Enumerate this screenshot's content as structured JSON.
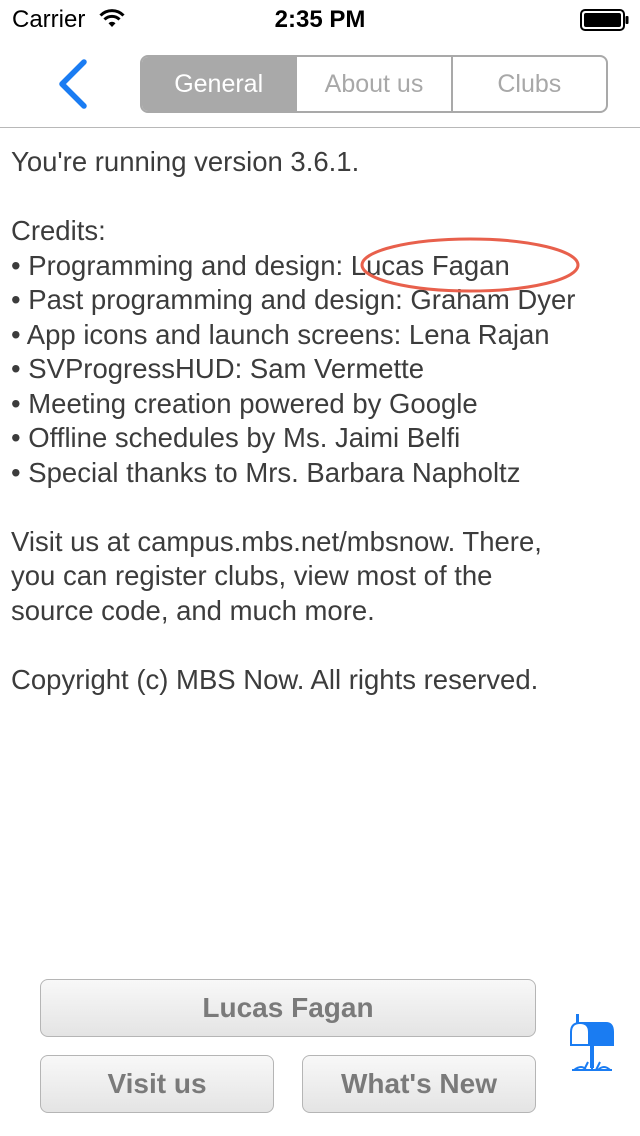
{
  "status_bar": {
    "carrier": "Carrier",
    "time": "2:35 PM",
    "wifi_icon": "wifi-icon",
    "battery_icon": "battery-icon"
  },
  "nav": {
    "back_icon": "chevron-left-icon",
    "tabs": [
      {
        "label": "General",
        "selected": true
      },
      {
        "label": "About us",
        "selected": false
      },
      {
        "label": "Clubs",
        "selected": false
      }
    ]
  },
  "content": {
    "version_text": "You're running version 3.6.1.",
    "credits_heading": "Credits:",
    "credits": [
      "• Programming and design: Lucas Fagan",
      "• Past programming and design: Graham Dyer",
      "• App icons and launch screens: Lena Rajan",
      "• SVProgressHUD: Sam Vermette",
      "• Meeting creation powered by Google",
      "• Offline schedules by Ms. Jaimi Belfi",
      "• Special thanks to Mrs. Barbara Napholtz"
    ],
    "visit_lines": [
      "Visit us at campus.mbs.net/mbsnow. There,",
      "you can register clubs, view most of the",
      "source code, and much more."
    ],
    "copyright": "Copyright (c) MBS Now. All rights reserved."
  },
  "buttons": {
    "name": "Lucas Fagan",
    "visit": "Visit us",
    "whats_new": "What's New"
  },
  "colors": {
    "accent": "#1a7cf2",
    "highlight": "#e8604c",
    "segment_selected": "#a9a9a9"
  },
  "icons": {
    "mailbox": "mailbox-icon"
  }
}
